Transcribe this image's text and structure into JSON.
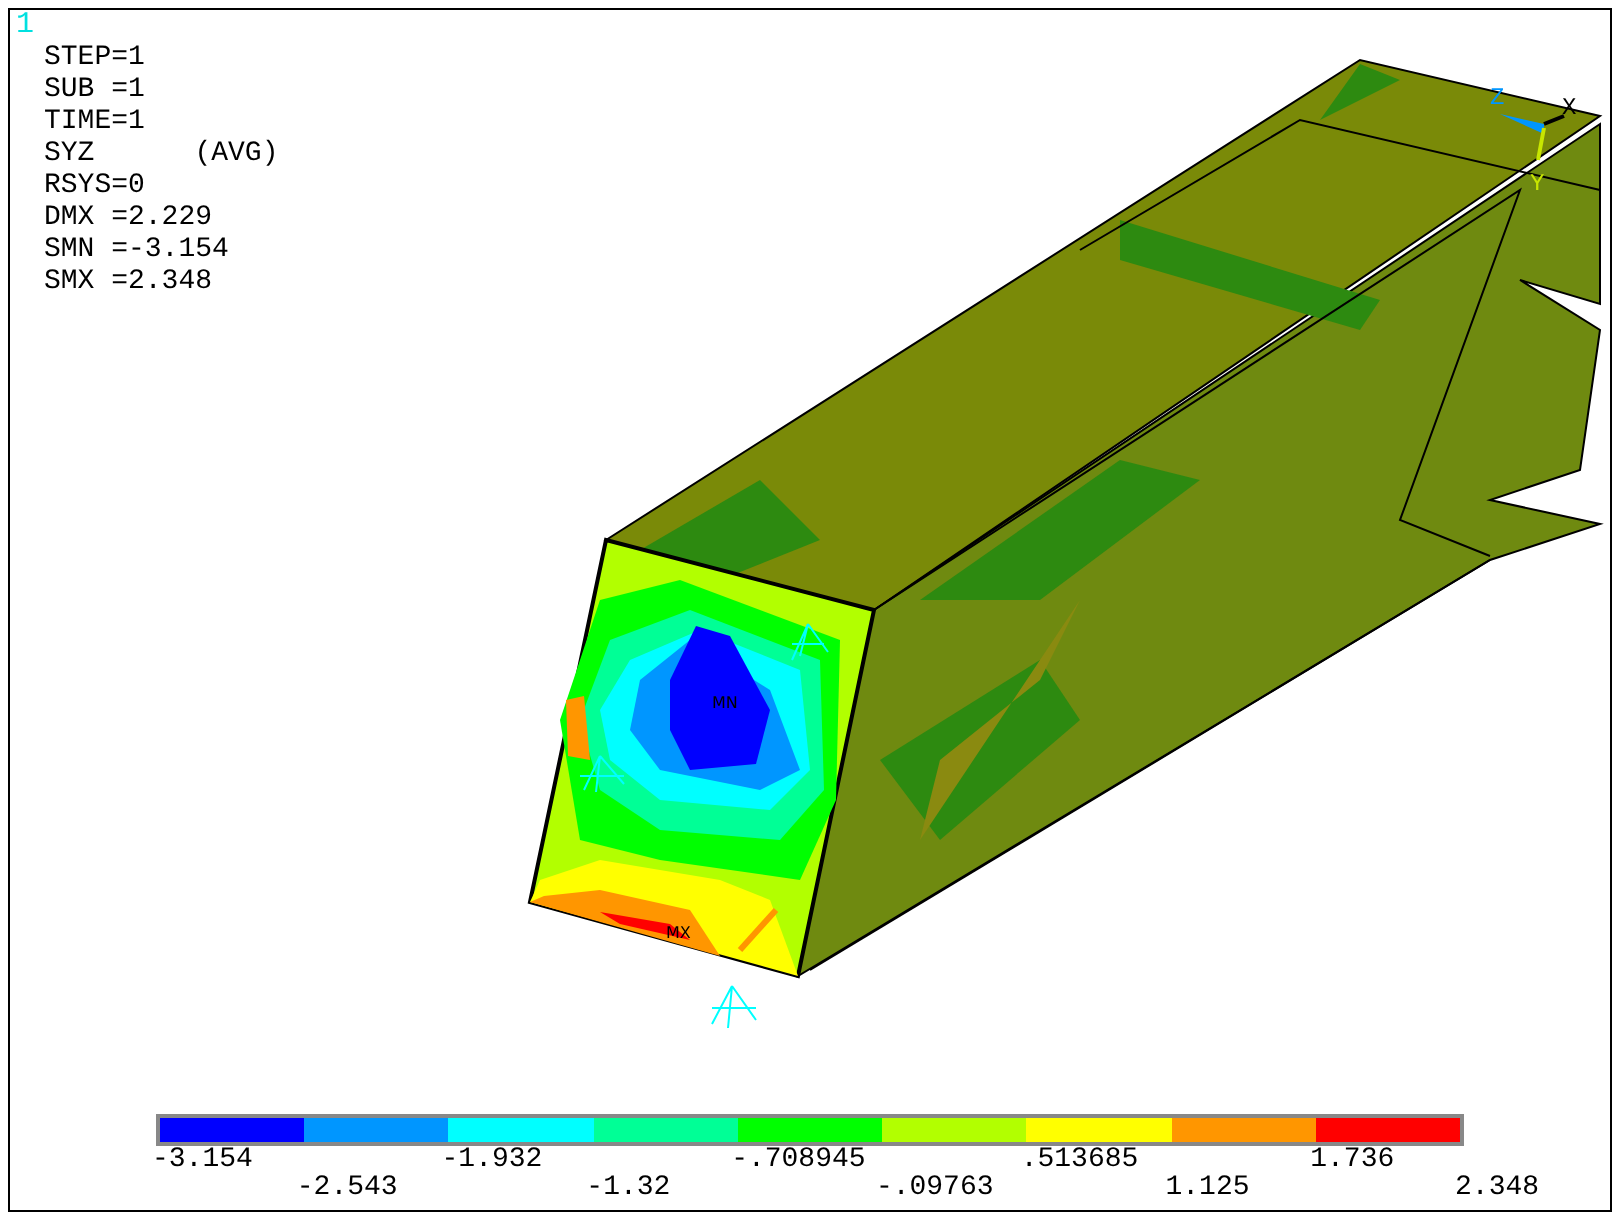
{
  "viewport_number": "1",
  "info": [
    {
      "text": "STEP=1"
    },
    {
      "text": "SUB =1"
    },
    {
      "text": "TIME=1"
    },
    {
      "text": "SYZ",
      "note": "(AVG)"
    },
    {
      "text": "RSYS=0"
    },
    {
      "text": "DMX =2.229"
    },
    {
      "text": "SMN =-3.154"
    },
    {
      "text": "SMX =2.348"
    }
  ],
  "markers": {
    "min": "MN",
    "max": "MX"
  },
  "triad": {
    "x": "X",
    "y": "Y",
    "z": "Z"
  },
  "legend": {
    "bands": [
      {
        "color": "#0000ff"
      },
      {
        "color": "#0096ff"
      },
      {
        "color": "#00ffff"
      },
      {
        "color": "#00ff96"
      },
      {
        "color": "#00ff00"
      },
      {
        "color": "#b2ff00"
      },
      {
        "color": "#ffff00"
      },
      {
        "color": "#ff9600"
      },
      {
        "color": "#ff0000"
      }
    ],
    "labels": [
      "-3.154",
      "-2.543",
      "-1.932",
      "-1.32",
      "-.708945",
      "-.09763",
      ".513685",
      "1.125",
      "1.736",
      "2.348"
    ]
  }
}
